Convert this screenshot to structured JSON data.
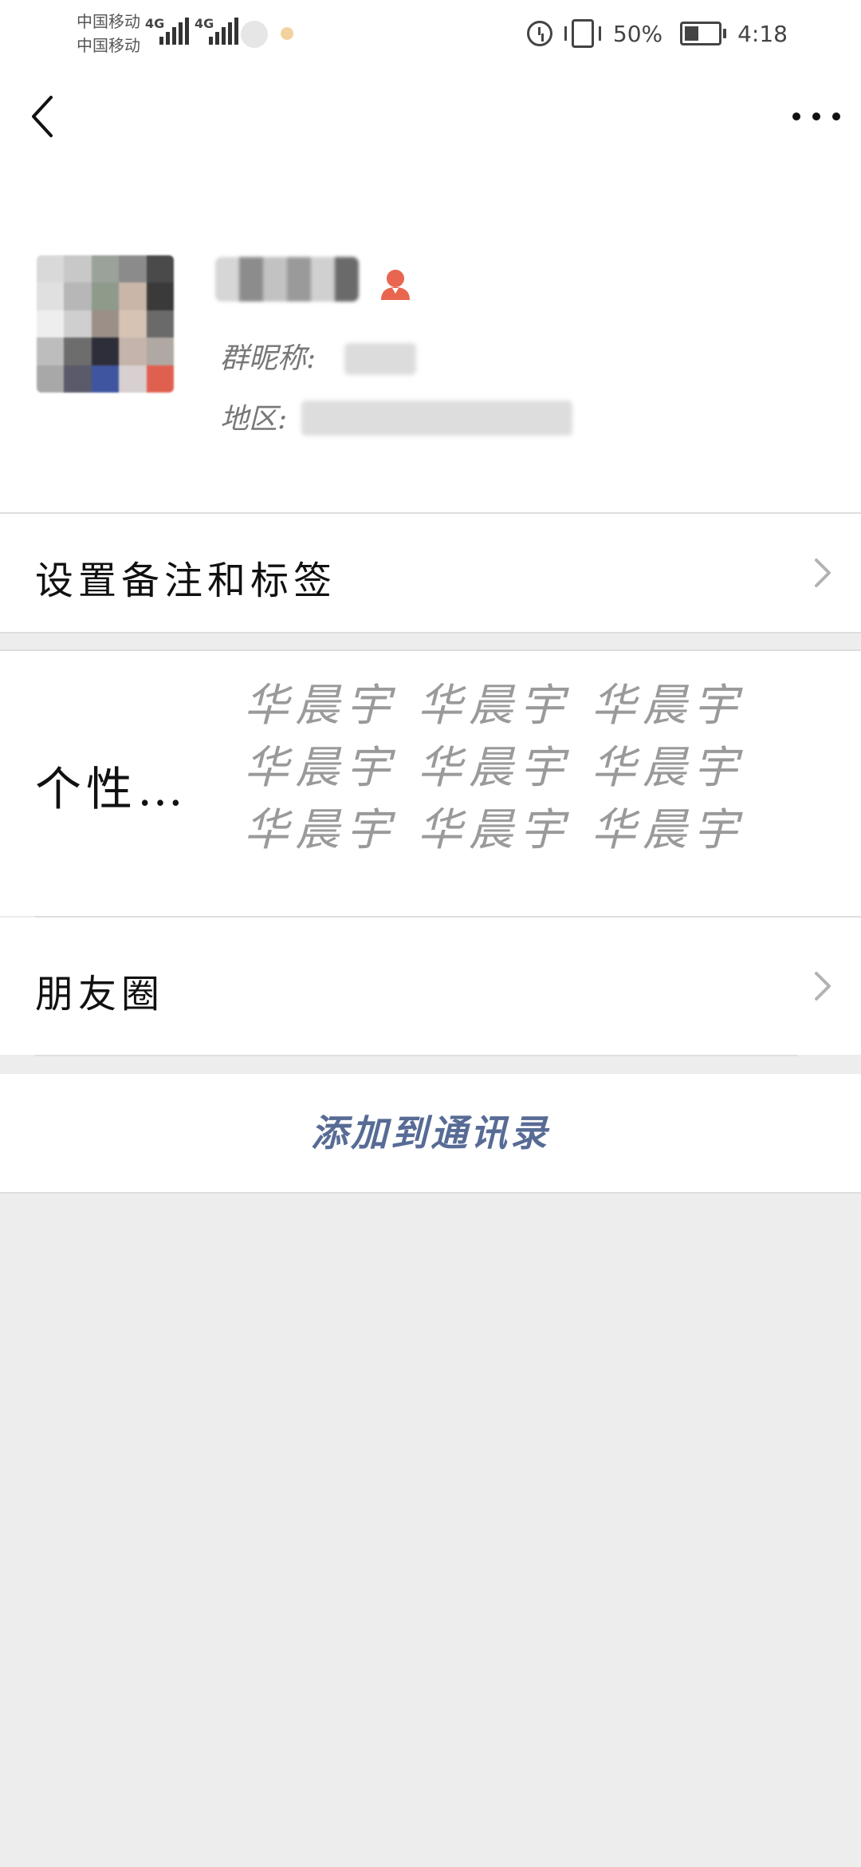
{
  "status_bar": {
    "carrier_1": "中国移动",
    "carrier_2": "中国移动",
    "network_1": "4G",
    "network_2": "4G",
    "battery": "50%",
    "battery_level": 0.5,
    "time": "4:18"
  },
  "profile": {
    "group_nickname_label": "群昵称:",
    "region_label": "地区:",
    "gender_icon": "female-icon",
    "gender_color": "#e8664f"
  },
  "rows": {
    "set_remark": "设置备注和标签",
    "signature_label": "个性…",
    "signature_value": "华晨宇 华晨宇 华晨宇 华晨宇 华晨宇 华晨宇 华晨宇 华晨宇 华晨宇",
    "moments": "朋友圈"
  },
  "add_to_contacts": "添加到通讯录",
  "colors": {
    "link": "#576b95",
    "background": "#ededed"
  }
}
